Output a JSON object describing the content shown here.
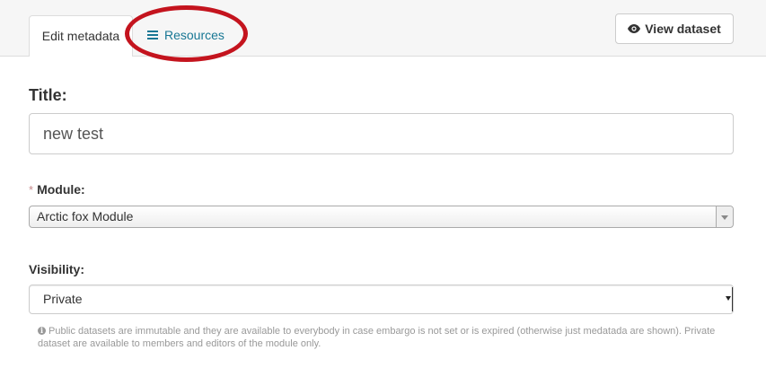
{
  "tabs": {
    "edit_metadata": "Edit metadata",
    "resources": "Resources"
  },
  "header": {
    "view_dataset": "View dataset"
  },
  "form": {
    "title_label": "Title:",
    "title_value": "new test",
    "module_required_marker": "*",
    "module_label": "Module:",
    "module_value": "Arctic fox Module",
    "visibility_label": "Visibility:",
    "visibility_value": "Private",
    "visibility_help": "Public datasets are immutable and they are available to everybody in case embargo is not set or is expired (otherwise just medatada are shown). Private dataset are available to members and editors of the module only."
  },
  "icons": {
    "resources_tab": "bars-icon",
    "view_dataset": "eye-icon",
    "help": "info-icon",
    "module_select": "chevron-down-icon"
  },
  "colors": {
    "link": "#187794",
    "annotation_oval": "#c4141e",
    "required_marker": "#c6898b"
  }
}
